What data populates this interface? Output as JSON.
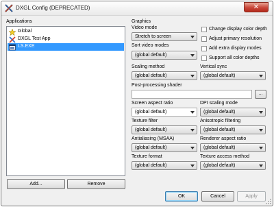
{
  "window": {
    "title": "DXGL Config (DEPRECATED)",
    "close_glyph": "✕",
    "icon": "dxgl-icon"
  },
  "applications": {
    "label": "Applications",
    "items": [
      {
        "label": "Global",
        "icon": "star-icon",
        "selected": false
      },
      {
        "label": "DXGL Test App",
        "icon": "dxgl-icon",
        "selected": false
      },
      {
        "label": "LS.EXE",
        "icon": "app-icon",
        "selected": true
      }
    ],
    "add_label": "Add...",
    "remove_label": "Remove"
  },
  "graphics": {
    "label": "Graphics",
    "video_mode": {
      "label": "Video mode",
      "value": "Stretch to screen"
    },
    "sort_video_modes": {
      "label": "Sort video modes",
      "value": "(global default)"
    },
    "scaling_method": {
      "label": "Scaling method",
      "value": "(global default)"
    },
    "vertical_sync": {
      "label": "Vertical sync",
      "value": "(global default)"
    },
    "post_processing_shader": {
      "label": "Post-processing shader",
      "value": "",
      "browse_label": "..."
    },
    "screen_aspect_ratio": {
      "label": "Screen aspect ratio",
      "value": "(global default)"
    },
    "dpi_scaling_mode": {
      "label": "DPI scaling mode",
      "value": "(global default)"
    },
    "texture_filter": {
      "label": "Texture filter",
      "value": "(global default)"
    },
    "anisotropic_filtering": {
      "label": "Anisotropic filtering",
      "value": "(global default)"
    },
    "antialiasing": {
      "label": "Antialiasing (MSAA)",
      "value": "(global default)"
    },
    "renderer_aspect_ratio": {
      "label": "Renderer aspect ratio",
      "value": "(global default)"
    },
    "texture_format": {
      "label": "Texture format",
      "value": "(global default)"
    },
    "texture_access_method": {
      "label": "Texture access method",
      "value": "(global default)"
    },
    "checkboxes": {
      "change_color_depth": {
        "label": "Change display color depth",
        "checked": false
      },
      "adjust_primary_resolution": {
        "label": "Adjust primary resolution",
        "checked": false
      },
      "add_extra_modes": {
        "label": "Add extra display modes",
        "checked": false
      },
      "support_all_color_depths": {
        "label": "Support all color depths",
        "checked": false
      }
    }
  },
  "dialog_buttons": {
    "ok": "OK",
    "cancel": "Cancel",
    "apply": "Apply"
  },
  "colors": {
    "selection": "#3399ff",
    "window_bg": "#f0f0f0",
    "close_button": "#c9473a"
  }
}
